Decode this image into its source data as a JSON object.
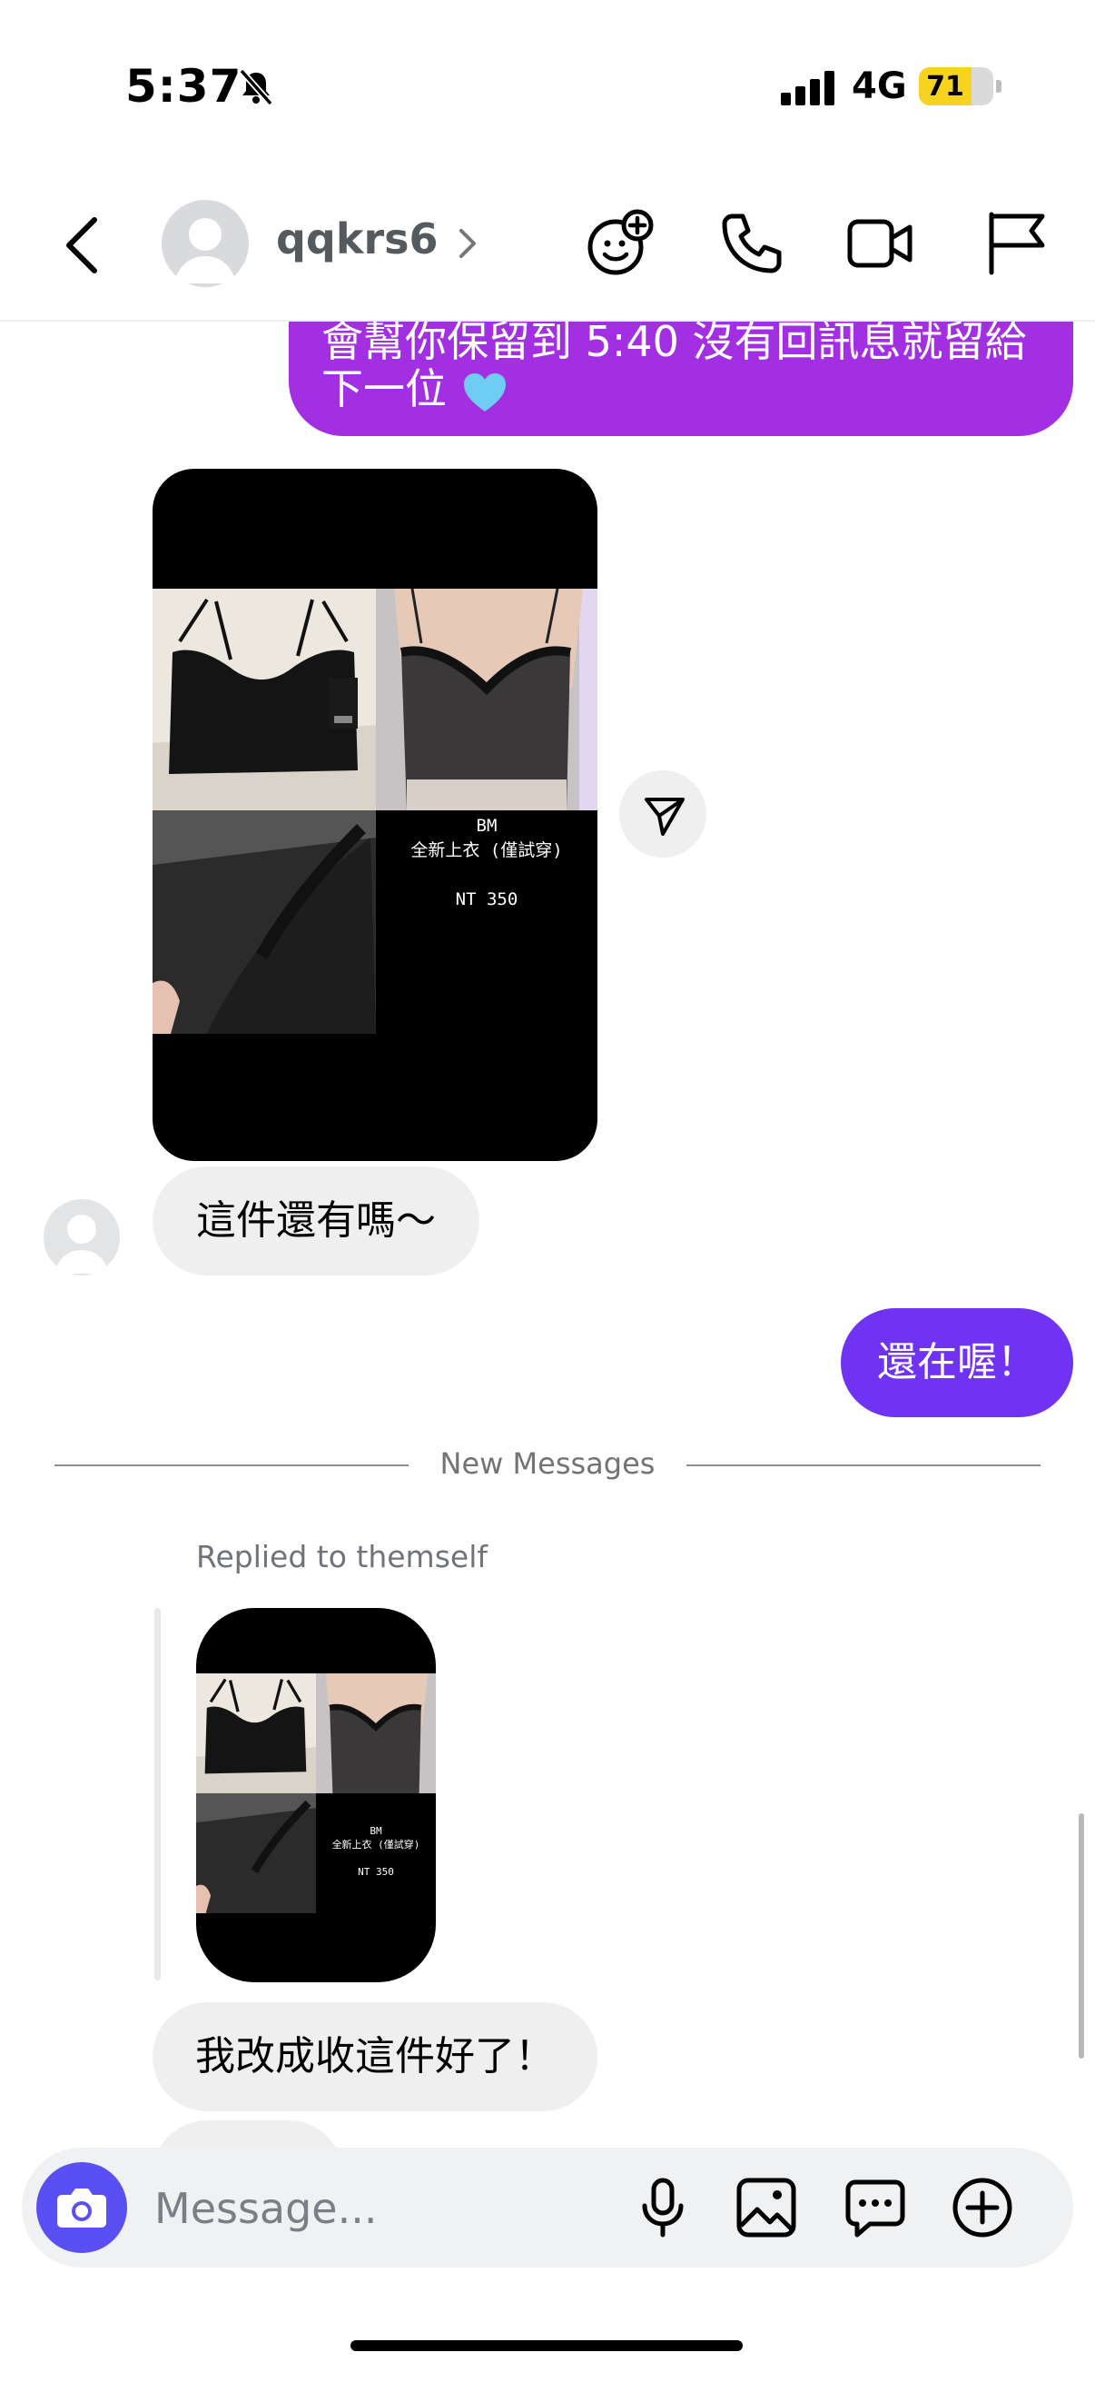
{
  "status_bar": {
    "time": "5:37",
    "network": "4G",
    "battery": 71
  },
  "header": {
    "username": "qqkrs6"
  },
  "messages": {
    "outgoing_top": {
      "line1": "會幫你保留到 5:40 沒有回訊息就留給",
      "line2": "下一位"
    },
    "shared_post": {
      "caption": [
        "BM",
        "全新上衣 (僅試穿)",
        "",
        "NT 350"
      ]
    },
    "incoming_1": "這件還有嗎～",
    "outgoing_2": "還在喔！",
    "divider": "New Messages",
    "reply_label": "Replied to themself",
    "incoming_2": "我改成收這件好了！"
  },
  "composer": {
    "placeholder": "Message..."
  },
  "colors": {
    "outgoing_purple": "#a32fe3",
    "outgoing_violet": "#7032f3",
    "camera_button": "#5a4ff3",
    "battery": "#f7d21f"
  }
}
